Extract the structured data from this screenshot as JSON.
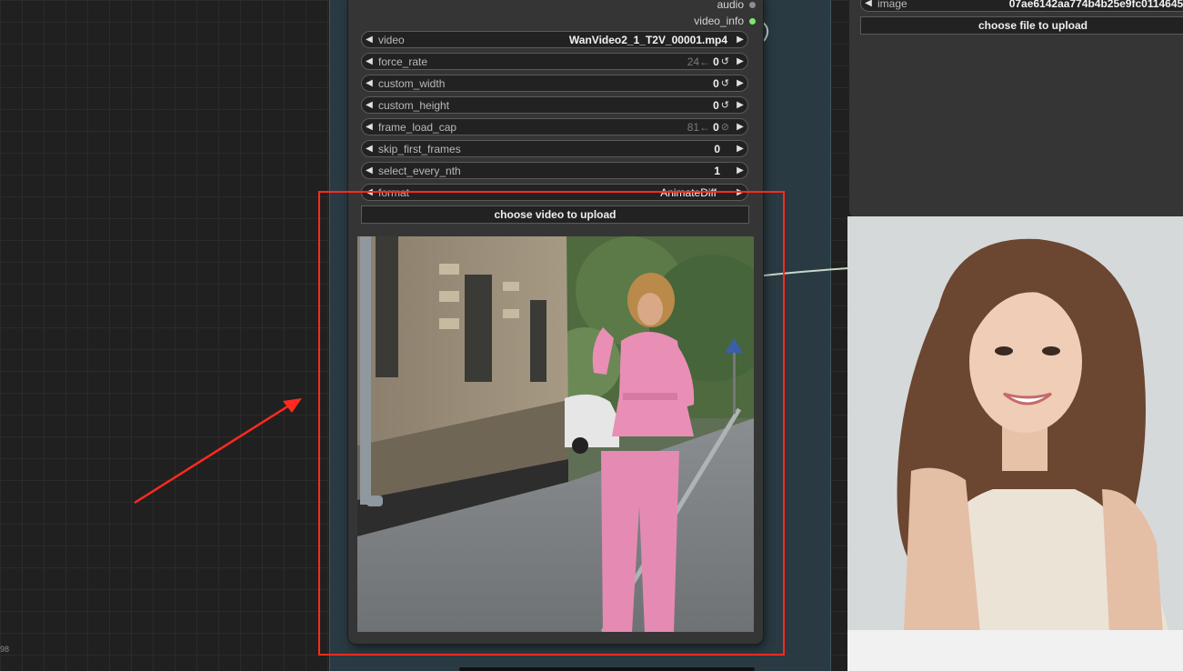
{
  "load_video_node": {
    "outputs": [
      {
        "label": "audio",
        "color": "#9a9a9a"
      },
      {
        "label": "video_info",
        "color": "#7de86a"
      }
    ],
    "widgets": [
      {
        "label": "video",
        "hint": "",
        "value": "WanVideo2_1_T2V_00001.mp4",
        "reset": ""
      },
      {
        "label": "force_rate",
        "hint": "24←",
        "value": "0",
        "reset": "↺"
      },
      {
        "label": "custom_width",
        "hint": "",
        "value": "0",
        "reset": "↺"
      },
      {
        "label": "custom_height",
        "hint": "",
        "value": "0",
        "reset": "↺"
      },
      {
        "label": "frame_load_cap",
        "hint": "81←",
        "value": "0",
        "reset": "⊘"
      },
      {
        "label": "skip_first_frames",
        "hint": "",
        "value": "0",
        "reset": ""
      },
      {
        "label": "select_every_nth",
        "hint": "",
        "value": "1",
        "reset": ""
      },
      {
        "label": "format",
        "hint": "",
        "value": "AnimateDiff",
        "reset": ""
      }
    ],
    "upload_label": "choose video to upload"
  },
  "load_image_node": {
    "image_label": "image",
    "image_value": "07ae6142aa774b4b25e9fc0114645",
    "upload_label": "choose file to upload"
  },
  "canvas": {
    "coord_text": "98"
  },
  "colors": {
    "highlight_box": "#ff2a1f",
    "arrow": "#ff2a1f",
    "group_band": "#2a3a42"
  }
}
